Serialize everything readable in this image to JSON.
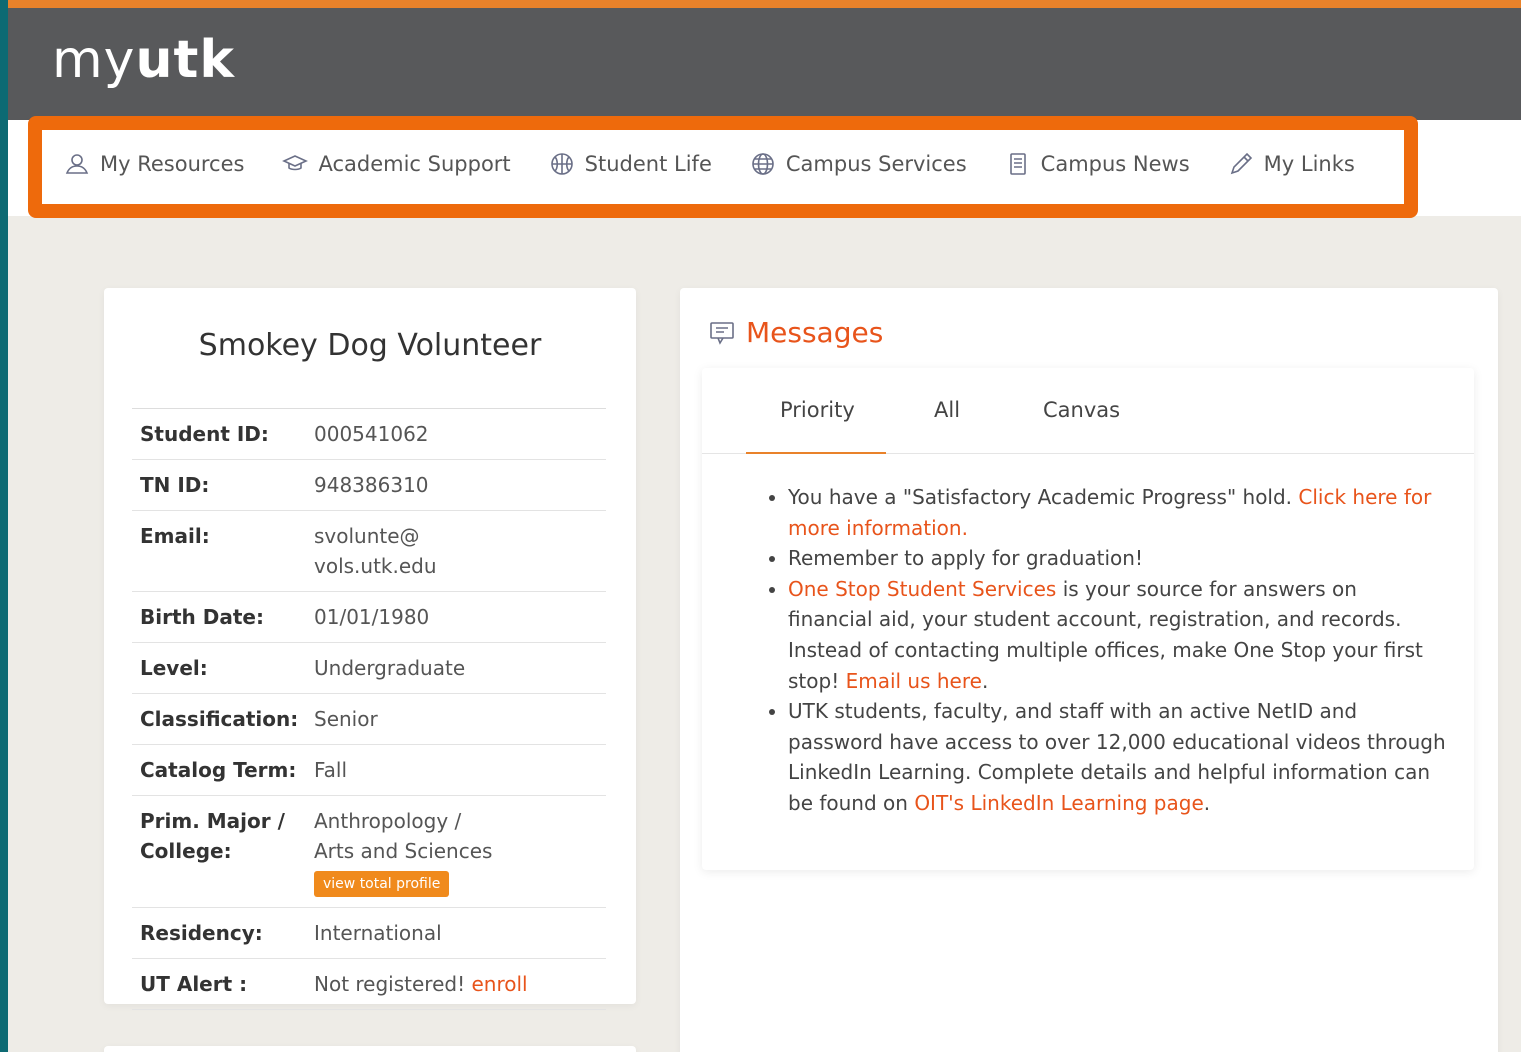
{
  "header": {
    "logo_my": "my",
    "logo_utk": "utk"
  },
  "nav": [
    {
      "label": "My Resources",
      "icon": "user-icon"
    },
    {
      "label": "Academic Support",
      "icon": "graduation-cap-icon"
    },
    {
      "label": "Student Life",
      "icon": "basketball-icon"
    },
    {
      "label": "Campus Services",
      "icon": "globe-icon"
    },
    {
      "label": "Campus News",
      "icon": "document-icon"
    },
    {
      "label": "My Links",
      "icon": "pencil-icon"
    }
  ],
  "profile": {
    "name": "Smokey Dog Volunteer",
    "student_id_label": "Student ID:",
    "student_id": "000541062",
    "tn_id_label": "TN ID:",
    "tn_id": "948386310",
    "email_label": "Email:",
    "email_line1": "svolunte@",
    "email_line2": "vols.utk.edu",
    "birth_label": "Birth Date:",
    "birth": "01/01/1980",
    "level_label": "Level:",
    "level": "Undergraduate",
    "class_label": "Classification:",
    "class": "Senior",
    "catalog_label": "Catalog Term:",
    "catalog": "Fall",
    "major_label_1": "Prim. Major /",
    "major_label_2": "College:",
    "major_1": "Anthropology /",
    "major_2": "Arts and Sciences",
    "view_profile": "view total profile",
    "residency_label": "Residency:",
    "residency": "International",
    "alert_label": "UT Alert :",
    "alert_text": "Not registered! ",
    "alert_link": "enroll"
  },
  "messages": {
    "title": "Messages",
    "tabs": [
      "Priority",
      "All",
      "Canvas"
    ],
    "m1_text": "You have a \"Satisfactory Academic Progress\" hold. ",
    "m1_link": "Click here for more information.",
    "m2_text": "Remember to apply for graduation!",
    "m3_link": "One Stop Student Services",
    "m3_text": " is your source for answers on financial aid, your student account, registration, and records. Instead of contacting multiple offices, make One Stop your first stop!  ",
    "m3_link2": "Email us here",
    "m3_end": ".",
    "m4_text": "UTK students, faculty, and staff with an active NetID and password have access to over 12,000 educational videos through LinkedIn Learning. Complete details and helpful information can be found on ",
    "m4_link": "OIT's LinkedIn Learning page",
    "m4_end": "."
  },
  "colors": {
    "accent": "#e8541b",
    "highlight": "#ee6a0c",
    "header": "#58595b"
  }
}
